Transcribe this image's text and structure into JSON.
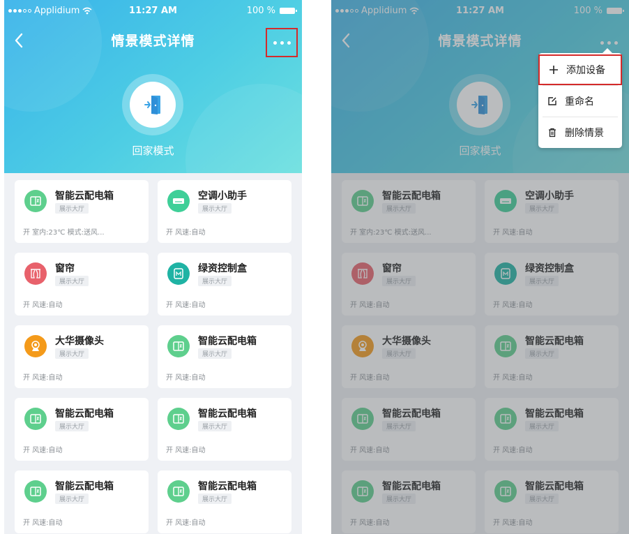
{
  "status_bar": {
    "carrier": "Applidium",
    "time": "11:27 AM",
    "battery": "100 %"
  },
  "header": {
    "title": "情景模式详情",
    "scene_name": "回家模式"
  },
  "devices": [
    {
      "name": "智能云配电箱",
      "location": "展示大厅",
      "status": "开 室内:23℃ 模式:送风...",
      "icon": "distribution-box-icon",
      "color": "#5ecf8d"
    },
    {
      "name": "空调小助手",
      "location": "展示大厅",
      "status": "开 风速:自动",
      "icon": "air-conditioner-icon",
      "color": "#3fcf98"
    },
    {
      "name": "窗帘",
      "location": "展示大厅",
      "status": "开 风速:自动",
      "icon": "curtain-icon",
      "color": "#e8616b"
    },
    {
      "name": "绿资控制盒",
      "location": "展示大厅",
      "status": "开 风速:自动",
      "icon": "control-box-icon",
      "color": "#1fb3a4"
    },
    {
      "name": "大华摄像头",
      "location": "展示大厅",
      "status": "开 风速:自动",
      "icon": "camera-icon",
      "color": "#f49a1a"
    },
    {
      "name": "智能云配电箱",
      "location": "展示大厅",
      "status": "开 风速:自动",
      "icon": "distribution-box-icon",
      "color": "#5ecf8d"
    },
    {
      "name": "智能云配电箱",
      "location": "展示大厅",
      "status": "开 风速:自动",
      "icon": "distribution-box-icon",
      "color": "#5ecf8d"
    },
    {
      "name": "智能云配电箱",
      "location": "展示大厅",
      "status": "开 风速:自动",
      "icon": "distribution-box-icon",
      "color": "#5ecf8d"
    },
    {
      "name": "智能云配电箱",
      "location": "展示大厅",
      "status": "开 风速:自动",
      "icon": "distribution-box-icon",
      "color": "#5ecf8d"
    },
    {
      "name": "智能云配电箱",
      "location": "展示大厅",
      "status": "开 风速:自动",
      "icon": "distribution-box-icon",
      "color": "#5ecf8d"
    }
  ],
  "menu": {
    "items": [
      {
        "label": "添加设备",
        "icon": "plus-icon"
      },
      {
        "label": "重命名",
        "icon": "edit-icon"
      },
      {
        "label": "删除情景",
        "icon": "trash-icon"
      }
    ]
  },
  "colors": {
    "header_start": "#38b2ea",
    "header_end": "#6de0df",
    "highlight": "#d42a2a",
    "page_bg": "#eff1f5"
  }
}
